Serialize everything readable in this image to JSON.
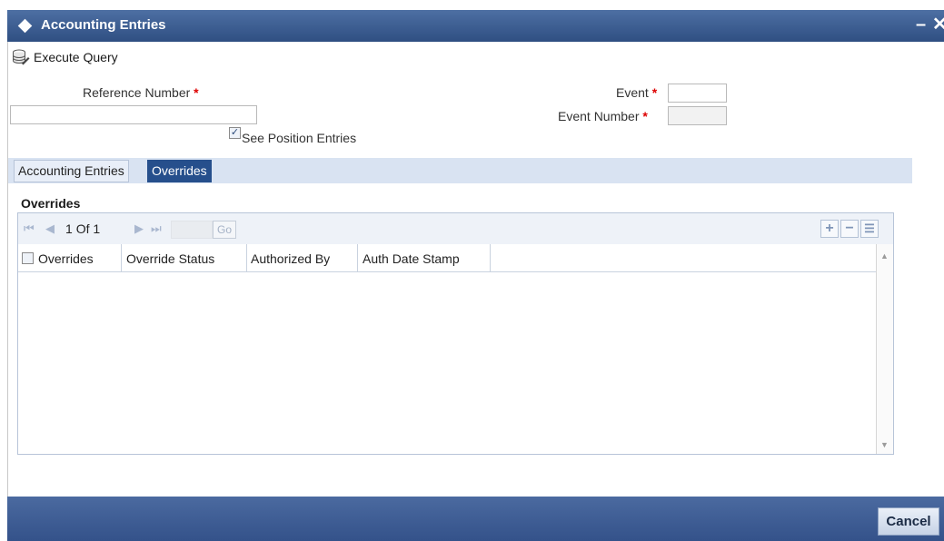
{
  "window": {
    "title": "Accounting Entries",
    "minimize_glyph": "–",
    "close_glyph": "✕"
  },
  "toolbar": {
    "execute_query_label": "Execute Query",
    "icon": "database-query-icon"
  },
  "form": {
    "reference_number_label": "Reference Number",
    "reference_number_value": "",
    "event_label": "Event",
    "event_value": "",
    "event_number_label": "Event Number",
    "event_number_value": "",
    "required_mark": "*",
    "see_position_entries_label": "See Position Entries",
    "see_position_entries_checked": true
  },
  "tabs": [
    {
      "label": "Accounting Entries",
      "active": false
    },
    {
      "label": "Overrides",
      "active": true
    }
  ],
  "overrides": {
    "section_title": "Overrides",
    "pager": {
      "current": "1",
      "of_label": "Of",
      "total": "1",
      "go_label": "Go"
    },
    "columns": [
      "Overrides",
      "Override Status",
      "Authorized By",
      "Auth Date Stamp"
    ],
    "rows": []
  },
  "footer": {
    "cancel_label": "Cancel"
  },
  "colors": {
    "titlebar": "#3a5a8c",
    "active_tab": "#264f8c",
    "required": "#d00000",
    "tabstrip": "#d9e3f2"
  }
}
